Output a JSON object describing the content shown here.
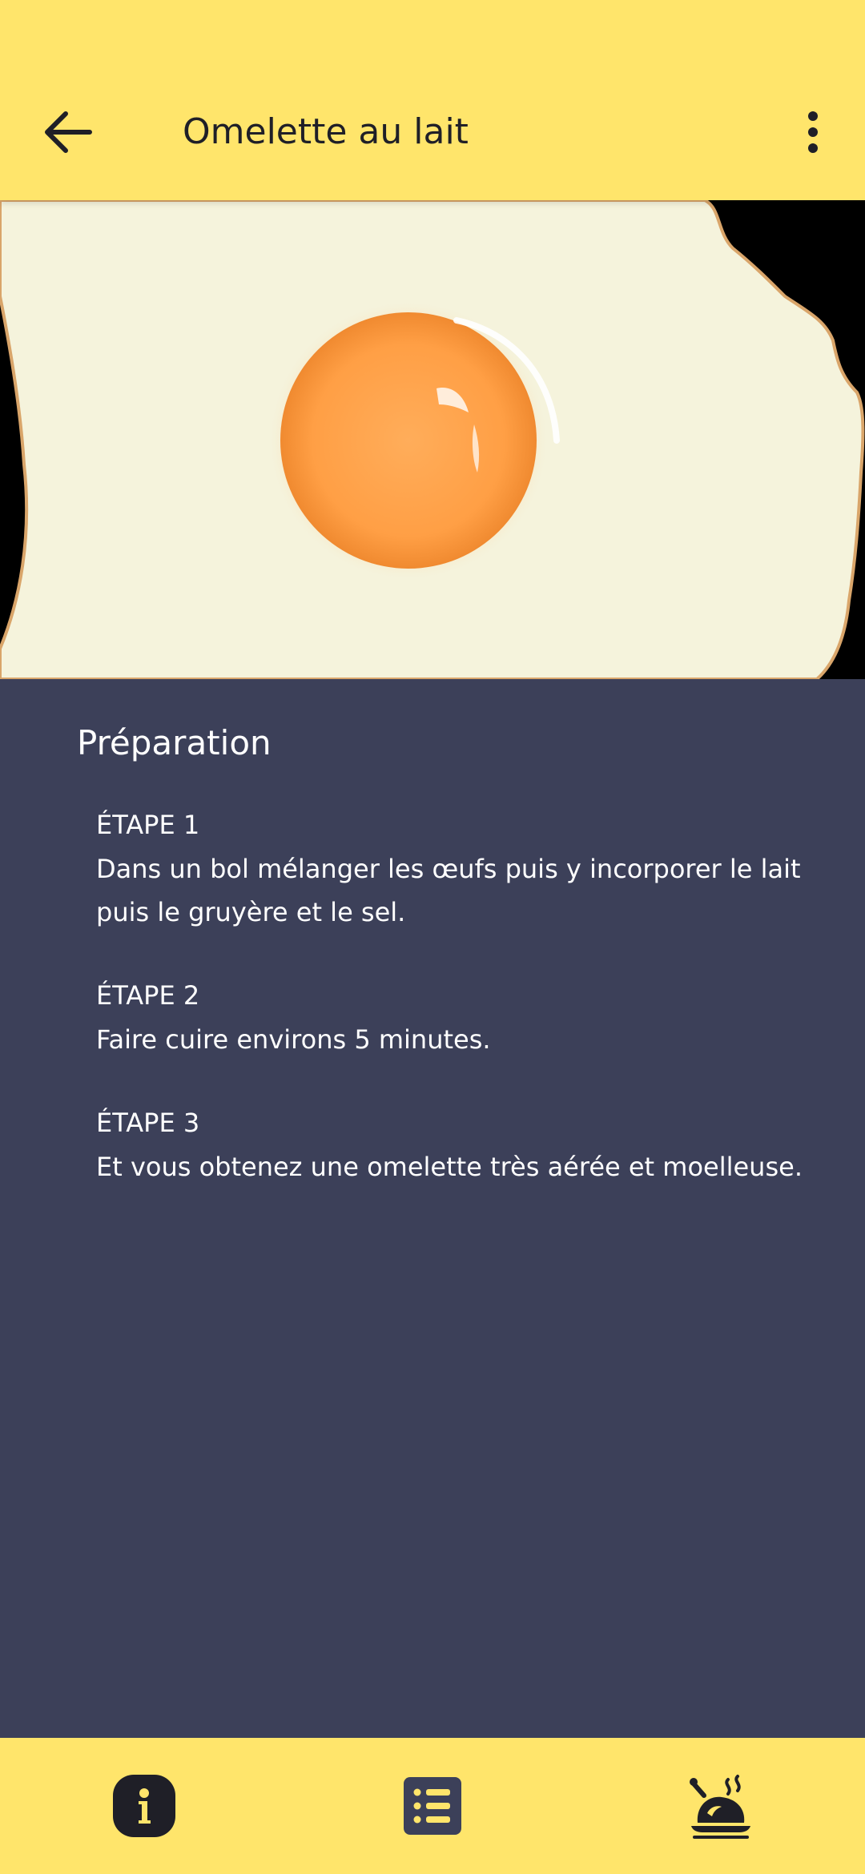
{
  "header": {
    "title": "Omelette au lait",
    "back_icon": "arrow-left-icon",
    "menu_icon": "more-vertical-icon"
  },
  "hero": {
    "image": "fried-egg-photo"
  },
  "preparation": {
    "title": "Préparation",
    "steps": [
      {
        "label": "ÉTAPE 1",
        "text": "Dans un bol mélanger les œufs puis y incorporer le lait puis le gruyère et le sel."
      },
      {
        "label": "ÉTAPE 2",
        "text": "Faire cuire environs 5 minutes."
      },
      {
        "label": "ÉTAPE 3",
        "text": "Et vous obtenez une omelette très aérée et moelleuse."
      }
    ]
  },
  "bottom_nav": {
    "items": [
      {
        "icon": "info-icon",
        "active": true
      },
      {
        "icon": "list-icon",
        "active": false
      },
      {
        "icon": "cooking-chicken-icon",
        "active": false
      }
    ]
  },
  "colors": {
    "accent": "#ffe56b",
    "background": "#3c4059",
    "text_dark": "#1f1f27",
    "text_light": "#ffffff"
  }
}
